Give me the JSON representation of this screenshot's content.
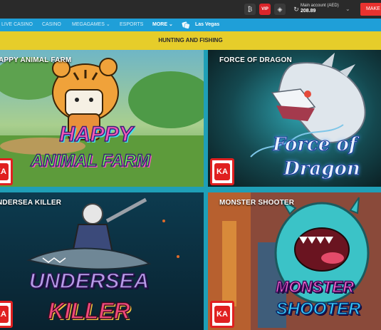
{
  "topbar": {
    "icons": [
      "bitcoin-icon",
      "vip-badge",
      "shield-icon",
      "refresh-icon"
    ],
    "vip_label": "VIP",
    "account_label": "Main account (AED)",
    "balance": "208.89",
    "cta_label": "MAKE"
  },
  "nav": {
    "items": [
      {
        "label": "LIVE CASINO"
      },
      {
        "label": "CASINO"
      },
      {
        "label": "MEGAGAMES ⌄"
      },
      {
        "label": "ESPORTS"
      },
      {
        "label": "MORE ⌄"
      },
      {
        "label": "Las Vegas"
      }
    ]
  },
  "category": {
    "title": "HUNTING AND FISHING"
  },
  "games": [
    {
      "title": "APPY ANIMAL FARM",
      "logo_line1": "HAPPY",
      "logo_line2": "ANIMAL FARM"
    },
    {
      "title": "FORCE OF DRAGON",
      "logo_line1": "Force of",
      "logo_line2": "Dragon"
    },
    {
      "title": "NDERSEA KILLER",
      "logo_line1": "UNDERSEA",
      "logo_line2": "KILLER"
    },
    {
      "title": "MONSTER SHOOTER",
      "logo_line1": "MONSTER",
      "logo_line2": "SHOOTER"
    }
  ],
  "provider_badge": "KA",
  "colors": {
    "nav_blue": "#1f9fd8",
    "category_yellow": "#e6cd2a",
    "cta_red": "#e8322f"
  }
}
